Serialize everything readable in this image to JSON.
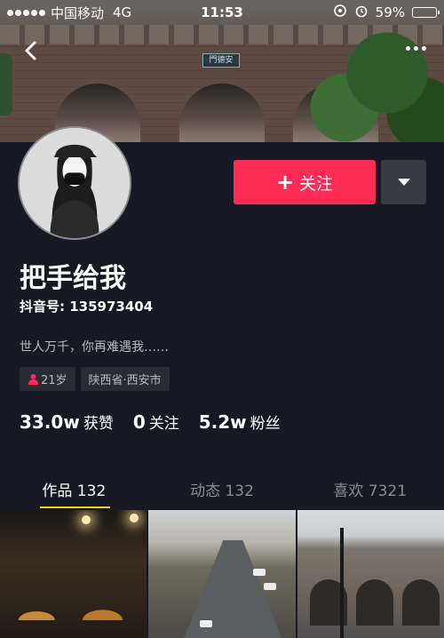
{
  "status_bar": {
    "carrier": "中国移动",
    "network": "4G",
    "time": "11:53",
    "battery": "59%",
    "battery_level": 0.59
  },
  "cover": {
    "plaque_text": "門德安"
  },
  "profile": {
    "follow_label": "关注",
    "nickname": "把手给我",
    "douyin_id": "抖音号: 135973404",
    "bio": "世人万千，你再难遇我……",
    "tags": {
      "age": "21岁",
      "location": "陕西省·西安市"
    },
    "stats": {
      "likes_num": "33.0w",
      "likes_label": "获赞",
      "following_num": "0",
      "following_label": "关注",
      "followers_num": "5.2w",
      "followers_label": "粉丝"
    }
  },
  "tabs": {
    "works": "作品 132",
    "moments": "动态 132",
    "likes": "喜欢 7321"
  },
  "icons": {
    "back": "back-arrow-icon",
    "more": "more-icon",
    "dropdown": "dropdown-caret-icon",
    "gender": "female-icon"
  },
  "colors": {
    "background": "#161823",
    "follow_button": "#fe2c55",
    "tab_indicator": "#face15"
  }
}
